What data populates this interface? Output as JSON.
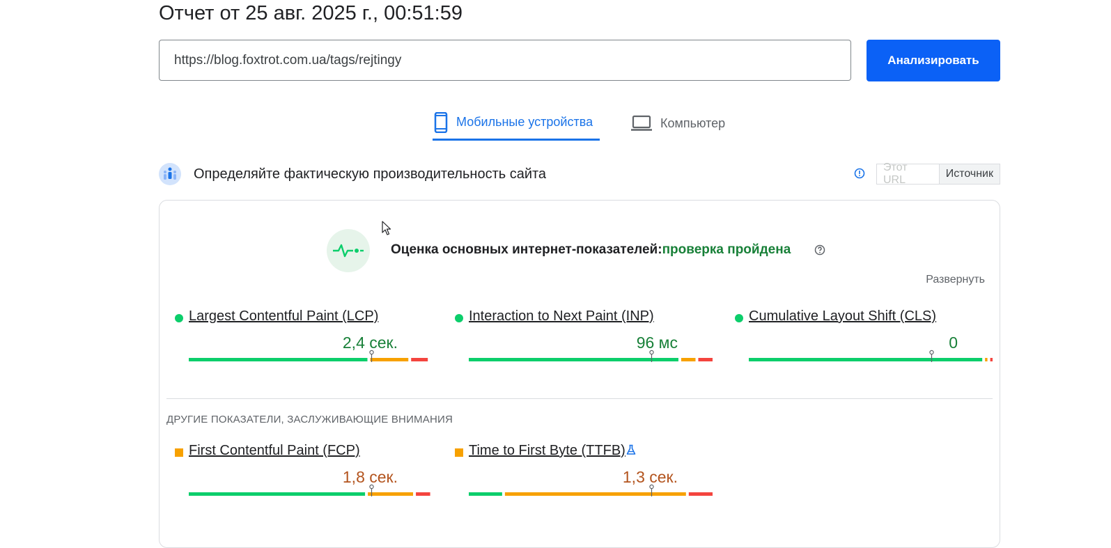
{
  "report": {
    "title": "Отчет от 25 авг. 2025 г., 00:51:59"
  },
  "search": {
    "url_value": "https://blog.foxtrot.com.ua/tags/rejtingy",
    "analyze_label": "Анализировать"
  },
  "tabs": [
    {
      "label": "Мобильные устройства",
      "icon": "smartphone-icon",
      "active": true
    },
    {
      "label": "Компьютер",
      "icon": "laptop-icon",
      "active": false
    }
  ],
  "field_data": {
    "heading": "Определяйте фактическую производительность сайта",
    "toggle": [
      {
        "label": "Этот URL",
        "enabled": false
      },
      {
        "label": "Источник",
        "enabled": true
      }
    ]
  },
  "cwv": {
    "assessment_label": "Оценка основных интернет-показателей:",
    "status": "проверка пройдена",
    "expand_label": "Развернуть"
  },
  "core_metrics": [
    {
      "name": "Largest Contentful Paint (LCP)",
      "value": "2,4 сек.",
      "rating": "good",
      "distribution": [
        0.75,
        0.16,
        0.07
      ],
      "marker": 0.75
    },
    {
      "name": "Interaction to Next Paint (INP)",
      "value": "96 мс",
      "rating": "good",
      "distribution": [
        0.88,
        0.06,
        0.06
      ],
      "marker": 0.75
    },
    {
      "name": "Cumulative Layout Shift (CLS)",
      "value": "0",
      "rating": "good",
      "distribution": [
        0.98,
        0.01,
        0.01
      ],
      "marker": 0.75
    }
  ],
  "other_heading": "ДРУГИЕ ПОКАЗАТЕЛИ, ЗАСЛУЖИВАЮЩИЕ ВНИМАНИЯ",
  "other_metrics": [
    {
      "name": "First Contentful Paint (FCP)",
      "value": "1,8 сек.",
      "rating": "average",
      "distribution": [
        0.74,
        0.19,
        0.06
      ],
      "marker": 0.75
    },
    {
      "name": "Time to First Byte (TTFB)",
      "value": "1,3 сек.",
      "rating": "average",
      "distribution": [
        0.14,
        0.76,
        0.1
      ],
      "marker": 0.75,
      "experimental": true
    }
  ],
  "colors": {
    "accent": "#1a73e8",
    "button": "#0b61f6",
    "good": "#0cce6b",
    "average": "#f7a100",
    "poor": "#f4443e",
    "pass_text": "#188038"
  }
}
